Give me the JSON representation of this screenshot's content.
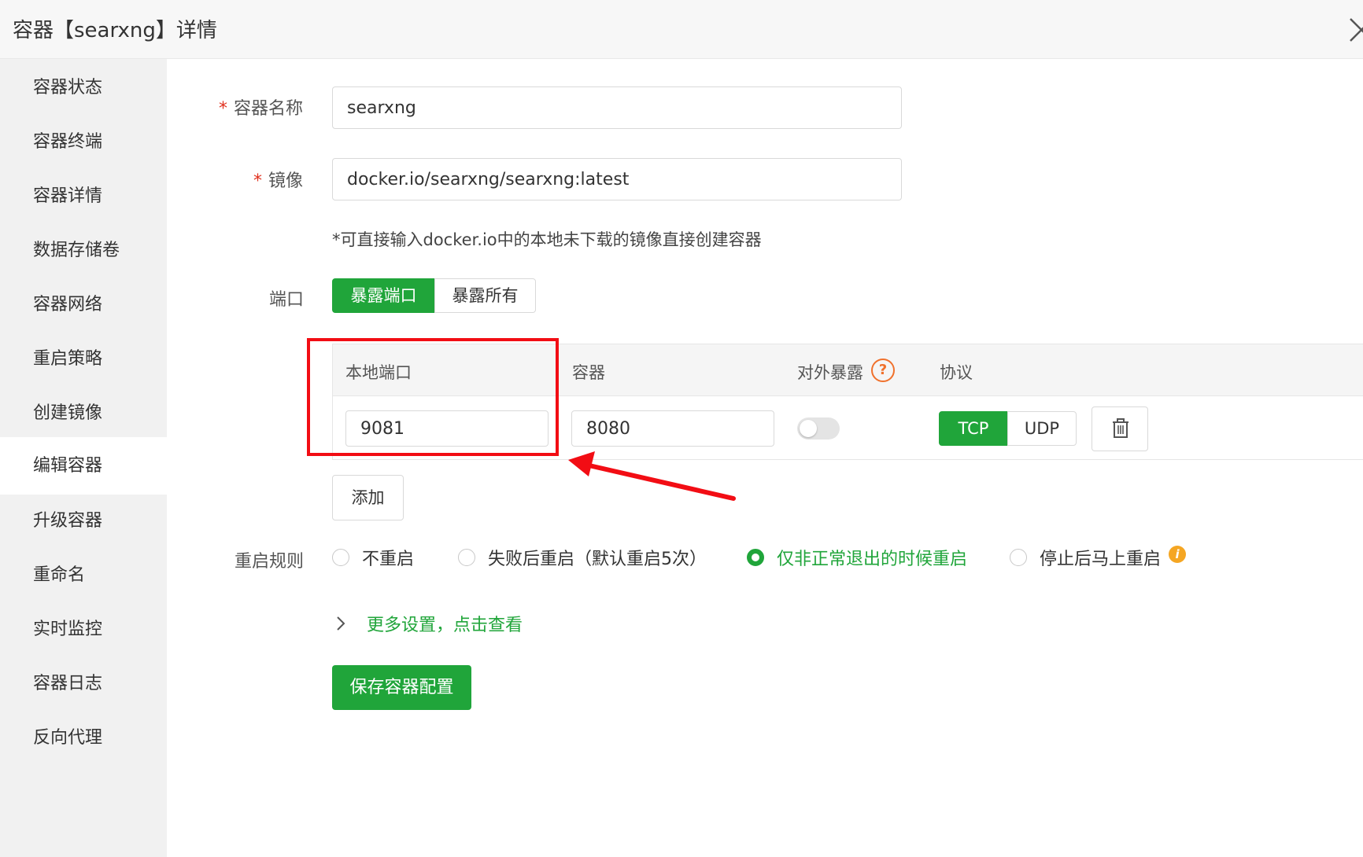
{
  "title": "容器【searxng】详情",
  "sidebar": {
    "items": [
      {
        "label": "容器状态"
      },
      {
        "label": "容器终端"
      },
      {
        "label": "容器详情"
      },
      {
        "label": "数据存储卷"
      },
      {
        "label": "容器网络"
      },
      {
        "label": "重启策略"
      },
      {
        "label": "创建镜像"
      },
      {
        "label": "编辑容器",
        "active": true
      },
      {
        "label": "升级容器"
      },
      {
        "label": "重命名"
      },
      {
        "label": "实时监控"
      },
      {
        "label": "容器日志"
      },
      {
        "label": "反向代理"
      }
    ]
  },
  "form": {
    "name_label": "容器名称",
    "name_value": "searxng",
    "image_label": "镜像",
    "image_value": "docker.io/searxng/searxng:latest",
    "image_hint": "*可直接输入docker.io中的本地未下载的镜像直接创建容器",
    "port_label": "端口",
    "port_mode": {
      "expose_ports": "暴露端口",
      "expose_all": "暴露所有",
      "selected": "暴露端口"
    },
    "port_table": {
      "headers": {
        "local": "本地端口",
        "container": "容器",
        "external": "对外暴露",
        "protocol": "协议"
      },
      "rows": [
        {
          "local": "9081",
          "container": "8080",
          "external_exposed": false,
          "tcp": "TCP",
          "udp": "UDP",
          "protocol": "TCP"
        }
      ]
    },
    "add_label": "添加",
    "restart_label": "重启规则",
    "restart_options": [
      {
        "label": "不重启",
        "checked": false
      },
      {
        "label": "失败后重启（默认重启5次）",
        "checked": false
      },
      {
        "label": "仅非正常退出的时候重启",
        "checked": true
      },
      {
        "label": "停止后马上重启",
        "checked": false
      }
    ],
    "more_settings": "更多设置，点击查看",
    "save_label": "保存容器配置"
  },
  "colors": {
    "accent": "#20a53a",
    "annotation": "#f20d14",
    "required": "#e0301e",
    "help": "#f0712c",
    "info": "#f5a623"
  },
  "icons": [
    "close-icon",
    "help-icon",
    "trash-icon",
    "info-icon",
    "chevron-right-icon"
  ]
}
